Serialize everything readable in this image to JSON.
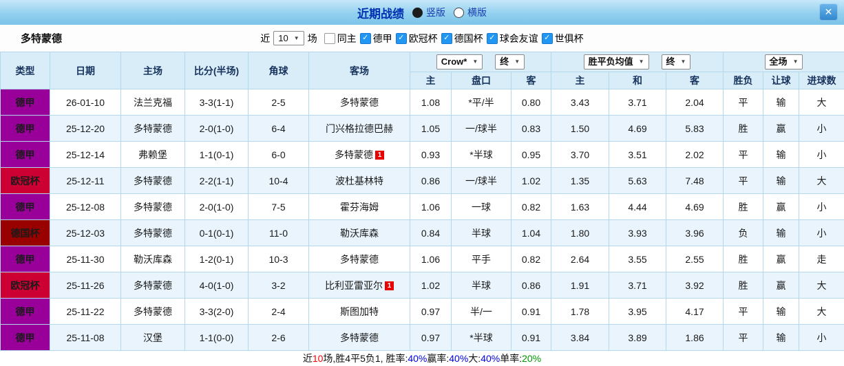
{
  "icons": {
    "arrow_down": "▼",
    "check": "✓",
    "close": "✕"
  },
  "colors": {
    "bundesliga_badge": "#990099",
    "ucl_badge": "#cc0033",
    "dfb_pokal_badge": "#990000",
    "dortmund_green": "#009933",
    "score_red": "#ff0000",
    "result_blue": "#0000e6",
    "result_green": "#009900",
    "checkbox_blue": "#2196f3",
    "header_bg": "#d9edf9",
    "alt_row_bg": "#e9f4fc",
    "topbar_blue": "#8fd0ef"
  },
  "top_bar": {
    "title": "近期战绩",
    "vertical_label": "竖版",
    "horizontal_label": "横版",
    "vertical_selected": true
  },
  "filter": {
    "team": "多特蒙德",
    "near_label": "近",
    "count_value": "10",
    "matches_label": "场",
    "checkboxes": [
      {
        "label": "同主",
        "checked": false
      },
      {
        "label": "德甲",
        "checked": true
      },
      {
        "label": "欧冠杯",
        "checked": true
      },
      {
        "label": "德国杯",
        "checked": true
      },
      {
        "label": "球会友谊",
        "checked": true
      },
      {
        "label": "世俱杯",
        "checked": true
      }
    ]
  },
  "table": {
    "top_headers": [
      "类型",
      "日期",
      "主场",
      "比分(半场)",
      "角球",
      "客场"
    ],
    "selects": {
      "odds_company": "Crow*",
      "odds_final": "终",
      "europe_avg": "胜平负均值",
      "europe_final": "终",
      "scope": "全场"
    },
    "sub_headers": [
      "主",
      "盘口",
      "客",
      "主",
      "和",
      "客",
      "胜负",
      "让球",
      "进球数"
    ],
    "rows": [
      {
        "league": "德甲",
        "league_color": "#990099",
        "date": "26-01-10",
        "home": "法兰克福",
        "home_green": false,
        "score": "3-3(1-1)",
        "corners": "2-5",
        "away": "多特蒙德",
        "away_green": true,
        "away_card": "",
        "asia": [
          "1.08",
          "*平/半",
          "0.80"
        ],
        "handicap_red": true,
        "europe": [
          "3.43",
          "3.71",
          "2.04"
        ],
        "result": {
          "text": "平",
          "color": "blue"
        },
        "give": {
          "text": "输",
          "color": "blue"
        },
        "goals": {
          "text": "大",
          "color": "red"
        }
      },
      {
        "league": "德甲",
        "league_color": "#990099",
        "date": "25-12-20",
        "home": "多特蒙德",
        "home_green": true,
        "score": "2-0(1-0)",
        "corners": "6-4",
        "away": "门兴格拉德巴赫",
        "away_green": false,
        "away_card": "",
        "asia": [
          "1.05",
          "一/球半",
          "0.83"
        ],
        "handicap_red": false,
        "europe": [
          "1.50",
          "4.69",
          "5.83"
        ],
        "result": {
          "text": "胜",
          "color": "red"
        },
        "give": {
          "text": "赢",
          "color": "red"
        },
        "goals": {
          "text": "小",
          "color": "green"
        }
      },
      {
        "league": "德甲",
        "league_color": "#990099",
        "date": "25-12-14",
        "home": "弗赖堡",
        "home_green": false,
        "score": "1-1(0-1)",
        "corners": "6-0",
        "away": "多特蒙德",
        "away_green": true,
        "away_card": "1",
        "asia": [
          "0.93",
          "*半球",
          "0.95"
        ],
        "handicap_red": true,
        "europe": [
          "3.70",
          "3.51",
          "2.02"
        ],
        "result": {
          "text": "平",
          "color": "blue"
        },
        "give": {
          "text": "输",
          "color": "blue"
        },
        "goals": {
          "text": "小",
          "color": "green"
        }
      },
      {
        "league": "欧冠杯",
        "league_color": "#cc0033",
        "date": "25-12-11",
        "home": "多特蒙德",
        "home_green": true,
        "score": "2-2(1-1)",
        "corners": "10-4",
        "away": "波杜基林特",
        "away_green": false,
        "away_card": "",
        "asia": [
          "0.86",
          "一/球半",
          "1.02"
        ],
        "handicap_red": false,
        "europe": [
          "1.35",
          "5.63",
          "7.48"
        ],
        "result": {
          "text": "平",
          "color": "blue"
        },
        "give": {
          "text": "输",
          "color": "blue"
        },
        "goals": {
          "text": "大",
          "color": "red"
        }
      },
      {
        "league": "德甲",
        "league_color": "#990099",
        "date": "25-12-08",
        "home": "多特蒙德",
        "home_green": true,
        "score": "2-0(1-0)",
        "corners": "7-5",
        "away": "霍芬海姆",
        "away_green": false,
        "away_card": "",
        "asia": [
          "1.06",
          "一球",
          "0.82"
        ],
        "handicap_red": false,
        "europe": [
          "1.63",
          "4.44",
          "4.69"
        ],
        "result": {
          "text": "胜",
          "color": "red"
        },
        "give": {
          "text": "赢",
          "color": "red"
        },
        "goals": {
          "text": "小",
          "color": "green"
        }
      },
      {
        "league": "德国杯",
        "league_color": "#990000",
        "date": "25-12-03",
        "home": "多特蒙德",
        "home_green": true,
        "score": "0-1(0-1)",
        "corners": "11-0",
        "away": "勒沃库森",
        "away_green": false,
        "away_card": "",
        "asia": [
          "0.84",
          "半球",
          "1.04"
        ],
        "handicap_red": false,
        "europe": [
          "1.80",
          "3.93",
          "3.96"
        ],
        "result": {
          "text": "负",
          "color": "blue"
        },
        "give": {
          "text": "输",
          "color": "blue"
        },
        "goals": {
          "text": "小",
          "color": "green"
        }
      },
      {
        "league": "德甲",
        "league_color": "#990099",
        "date": "25-11-30",
        "home": "勒沃库森",
        "home_green": false,
        "score": "1-2(0-1)",
        "corners": "10-3",
        "away": "多特蒙德",
        "away_green": true,
        "away_card": "",
        "asia": [
          "1.06",
          "平手",
          "0.82"
        ],
        "handicap_red": false,
        "europe": [
          "2.64",
          "3.55",
          "2.55"
        ],
        "result": {
          "text": "胜",
          "color": "red"
        },
        "give": {
          "text": "赢",
          "color": "red"
        },
        "goals": {
          "text": "走",
          "color": "blue"
        }
      },
      {
        "league": "欧冠杯",
        "league_color": "#cc0033",
        "date": "25-11-26",
        "home": "多特蒙德",
        "home_green": true,
        "score": "4-0(1-0)",
        "corners": "3-2",
        "away": "比利亚雷亚尔",
        "away_green": false,
        "away_card": "1",
        "asia": [
          "1.02",
          "半球",
          "0.86"
        ],
        "handicap_red": false,
        "europe": [
          "1.91",
          "3.71",
          "3.92"
        ],
        "result": {
          "text": "胜",
          "color": "red"
        },
        "give": {
          "text": "赢",
          "color": "red"
        },
        "goals": {
          "text": "大",
          "color": "red"
        }
      },
      {
        "league": "德甲",
        "league_color": "#990099",
        "date": "25-11-22",
        "home": "多特蒙德",
        "home_green": true,
        "score": "3-3(2-0)",
        "corners": "2-4",
        "away": "斯图加特",
        "away_green": false,
        "away_card": "",
        "asia": [
          "0.97",
          "半/一",
          "0.91"
        ],
        "handicap_red": false,
        "europe": [
          "1.78",
          "3.95",
          "4.17"
        ],
        "result": {
          "text": "平",
          "color": "blue"
        },
        "give": {
          "text": "输",
          "color": "blue"
        },
        "goals": {
          "text": "大",
          "color": "red"
        }
      },
      {
        "league": "德甲",
        "league_color": "#990099",
        "date": "25-11-08",
        "home": "汉堡",
        "home_green": false,
        "score": "1-1(0-0)",
        "corners": "2-6",
        "away": "多特蒙德",
        "away_green": true,
        "away_card": "",
        "asia": [
          "0.97",
          "*半球",
          "0.91"
        ],
        "handicap_red": true,
        "europe": [
          "3.84",
          "3.89",
          "1.86"
        ],
        "result": {
          "text": "平",
          "color": "blue"
        },
        "give": {
          "text": "输",
          "color": "blue"
        },
        "goals": {
          "text": "小",
          "color": "green"
        }
      }
    ]
  },
  "footer": {
    "segments": [
      {
        "text": "近",
        "color": "black"
      },
      {
        "text": "10",
        "color": "red"
      },
      {
        "text": "场,胜4平5负1, 胜率:",
        "color": "black"
      },
      {
        "text": "40%",
        "color": "blue"
      },
      {
        "text": " 赢率:",
        "color": "black"
      },
      {
        "text": "40%",
        "color": "blue"
      },
      {
        "text": " 大:",
        "color": "black"
      },
      {
        "text": "40%",
        "color": "blue"
      },
      {
        "text": " 单率:",
        "color": "black"
      },
      {
        "text": "20%",
        "color": "green"
      }
    ]
  }
}
